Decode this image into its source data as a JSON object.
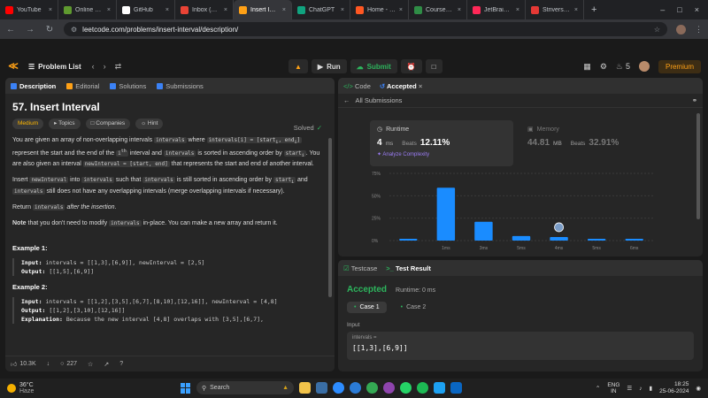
{
  "browser": {
    "tabs": [
      {
        "label": "YouTube",
        "color": "#ff0000",
        "active": false
      },
      {
        "label": "Online Sh...",
        "color": "#5f9a2f",
        "active": false
      },
      {
        "label": "GitHub",
        "color": "#ffffff",
        "active": false
      },
      {
        "label": "Inbox (4,1...",
        "color": "#ea4335",
        "active": false
      },
      {
        "label": "Insert Inte...",
        "color": "#ffa116",
        "active": true
      },
      {
        "label": "ChatGPT",
        "color": "#10a37f",
        "active": false
      },
      {
        "label": "Home - Re...",
        "color": "#ff5722",
        "active": false
      },
      {
        "label": "Courses G...",
        "color": "#2f8d46",
        "active": false
      },
      {
        "label": "JetBrains ...",
        "color": "#fe2857",
        "active": false
      },
      {
        "label": "Strivers A...",
        "color": "#e53935",
        "active": false
      }
    ],
    "url": "leetcode.com/problems/insert-interval/description/"
  },
  "header": {
    "problem_list": "Problem List",
    "run": "Run",
    "submit": "Submit",
    "streak": "5",
    "premium": "Premium"
  },
  "left": {
    "tabs": {
      "description": "Description",
      "editorial": "Editorial",
      "solutions": "Solutions",
      "submissions": "Submissions"
    },
    "title": "57. Insert Interval",
    "solved": "Solved",
    "tags": {
      "difficulty": "Medium",
      "topics": "Topics",
      "companies": "Companies",
      "hint": "Hint"
    },
    "likes": "10.3K",
    "comments": "227"
  },
  "right": {
    "tabs": {
      "code": "Code",
      "accepted": "Accepted"
    },
    "all_submissions": "All Submissions",
    "runtime": {
      "label": "Runtime",
      "value": "4",
      "unit": "ms",
      "beats_label": "Beats",
      "beats": "12.11%",
      "analyze": "Analyze Complexity"
    },
    "memory": {
      "label": "Memory",
      "value": "44.81",
      "unit": "MB",
      "beats_label": "Beats",
      "beats": "32.91%"
    }
  },
  "result": {
    "tabs": {
      "testcase": "Testcase",
      "test_result": "Test Result"
    },
    "status": "Accepted",
    "runtime": "Runtime: 0 ms",
    "cases": [
      "Case 1",
      "Case 2"
    ],
    "input_label": "Input",
    "input_name": "intervals =",
    "input_value": "[[1,3],[6,9]]"
  },
  "taskbar": {
    "temp": "36°C",
    "weather": "Haze",
    "search": "Search",
    "lang": "ENG",
    "region": "IN",
    "time": "18:25",
    "date": "25-06-2024"
  },
  "chart_data": {
    "type": "bar",
    "categories": [
      "0ms",
      "1ms",
      "2ms",
      "3ms",
      "4ms",
      "5ms",
      "6ms"
    ],
    "values": [
      2,
      59,
      21,
      5,
      4,
      2,
      2
    ],
    "xtick_labels": [
      "1ms",
      "3ms",
      "5ms",
      "4ms",
      "5ms",
      "6ms"
    ],
    "ylim": [
      0,
      75
    ],
    "yticks": [
      "0%",
      "25%",
      "50%",
      "75%"
    ],
    "highlight_category": "4ms",
    "bar_color": "#1a8cff"
  }
}
